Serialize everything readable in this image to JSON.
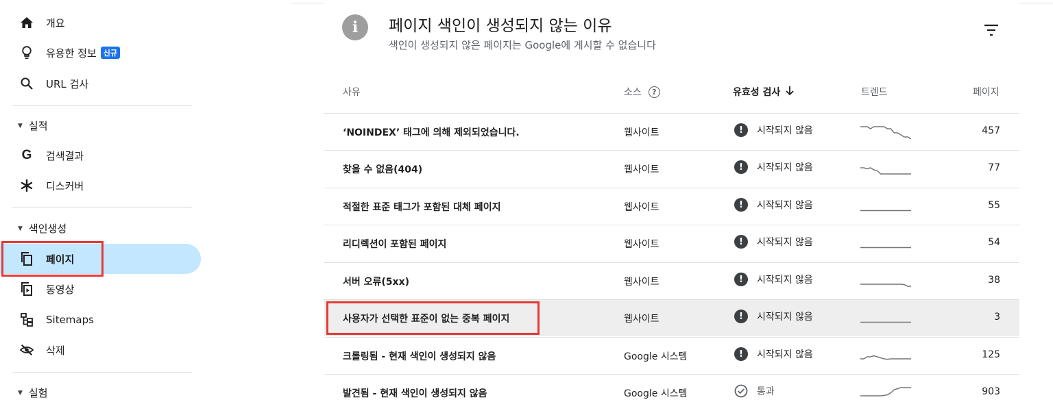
{
  "sidebar": {
    "items": [
      {
        "label": "개요",
        "icon": "home-icon"
      },
      {
        "label": "유용한 정보",
        "badge": "신규",
        "icon": "lightbulb-icon"
      },
      {
        "label": "URL 검사",
        "icon": "search-icon"
      }
    ],
    "sections": [
      {
        "label": "실적",
        "items": [
          {
            "label": "검색결과",
            "icon": "google-g-icon"
          },
          {
            "label": "디스커버",
            "icon": "asterisk-icon"
          }
        ]
      },
      {
        "label": "색인생성",
        "items": [
          {
            "label": "페이지",
            "icon": "pages-icon"
          },
          {
            "label": "동영상",
            "icon": "video-icon"
          },
          {
            "label": "Sitemaps",
            "icon": "sitemap-icon"
          },
          {
            "label": "삭제",
            "icon": "eye-off-icon"
          }
        ]
      },
      {
        "label": "실험",
        "items": []
      }
    ]
  },
  "card": {
    "title": "페이지 색인이 생성되지 않는 이유",
    "subtitle": "색인이 생성되지 않은 페이지는 Google에 게시할 수 없습니다",
    "columns": {
      "reason": "사유",
      "source": "소스",
      "validation": "유효성 검사",
      "trend": "트렌드",
      "pages": "페이지"
    }
  },
  "rows": [
    {
      "reason": "‘NOINDEX’ 태그에 의해 제외되었습니다.",
      "source": "웹사이트",
      "status": "시작되지 않음",
      "status_type": "not-started",
      "pages": "457",
      "trend": [
        0.3,
        0.3,
        0.3,
        0.4,
        0.3,
        0.3,
        0.3,
        0.3,
        0.4,
        0.4,
        0.6,
        0.6,
        0.7,
        0.8,
        0.8,
        0.9
      ]
    },
    {
      "reason": "찾을 수 없음(404)",
      "source": "웹사이트",
      "status": "시작되지 않음",
      "status_type": "not-started",
      "pages": "77",
      "trend": [
        0.5,
        0.5,
        0.55,
        0.5,
        0.6,
        0.65,
        0.8,
        0.8,
        0.8,
        0.8,
        0.8,
        0.8,
        0.8,
        0.8,
        0.8,
        0.8
      ]
    },
    {
      "reason": "적절한 표준 태그가 포함된 대체 페이지",
      "source": "웹사이트",
      "status": "시작되지 않음",
      "status_type": "not-started",
      "pages": "55",
      "trend": [
        0.75,
        0.75,
        0.75,
        0.75,
        0.75,
        0.75,
        0.75,
        0.75,
        0.75,
        0.75,
        0.75,
        0.75,
        0.75,
        0.75,
        0.75,
        0.75
      ]
    },
    {
      "reason": "리디렉션이 포함된 페이지",
      "source": "웹사이트",
      "status": "시작되지 않음",
      "status_type": "not-started",
      "pages": "54",
      "trend": [
        0.75,
        0.75,
        0.75,
        0.75,
        0.75,
        0.75,
        0.75,
        0.75,
        0.75,
        0.75,
        0.75,
        0.75,
        0.75,
        0.75,
        0.75,
        0.75
      ]
    },
    {
      "reason": "서버 오류(5xx)",
      "source": "웹사이트",
      "status": "시작되지 않음",
      "status_type": "not-started",
      "pages": "38",
      "trend": [
        0.7,
        0.7,
        0.7,
        0.7,
        0.7,
        0.7,
        0.7,
        0.7,
        0.7,
        0.7,
        0.7,
        0.7,
        0.7,
        0.72,
        0.8,
        0.8
      ]
    },
    {
      "reason": "사용자가 선택한 표준이 없는 중복 페이지",
      "source": "웹사이트",
      "status": "시작되지 않음",
      "status_type": "not-started",
      "pages": "3",
      "trend": [
        0.75,
        0.75,
        0.75,
        0.75,
        0.75,
        0.75,
        0.75,
        0.75,
        0.75,
        0.75,
        0.75,
        0.75,
        0.75,
        0.75,
        0.75,
        0.75
      ]
    },
    {
      "reason": "크롤링됨 - 현재 색인이 생성되지 않음",
      "source": "Google 시스템",
      "status": "시작되지 않음",
      "status_type": "not-started",
      "pages": "125",
      "trend": [
        0.7,
        0.7,
        0.6,
        0.6,
        0.55,
        0.6,
        0.65,
        0.7,
        0.72,
        0.7,
        0.7,
        0.7,
        0.7,
        0.7,
        0.7,
        0.7
      ]
    },
    {
      "reason": "발견됨 - 현재 색인이 생성되지 않음",
      "source": "Google 시스템",
      "status": "통과",
      "status_type": "passed",
      "pages": "903",
      "trend": [
        0.7,
        0.7,
        0.7,
        0.7,
        0.7,
        0.7,
        0.7,
        0.68,
        0.65,
        0.55,
        0.4,
        0.35,
        0.3,
        0.3,
        0.3,
        0.3
      ]
    }
  ]
}
